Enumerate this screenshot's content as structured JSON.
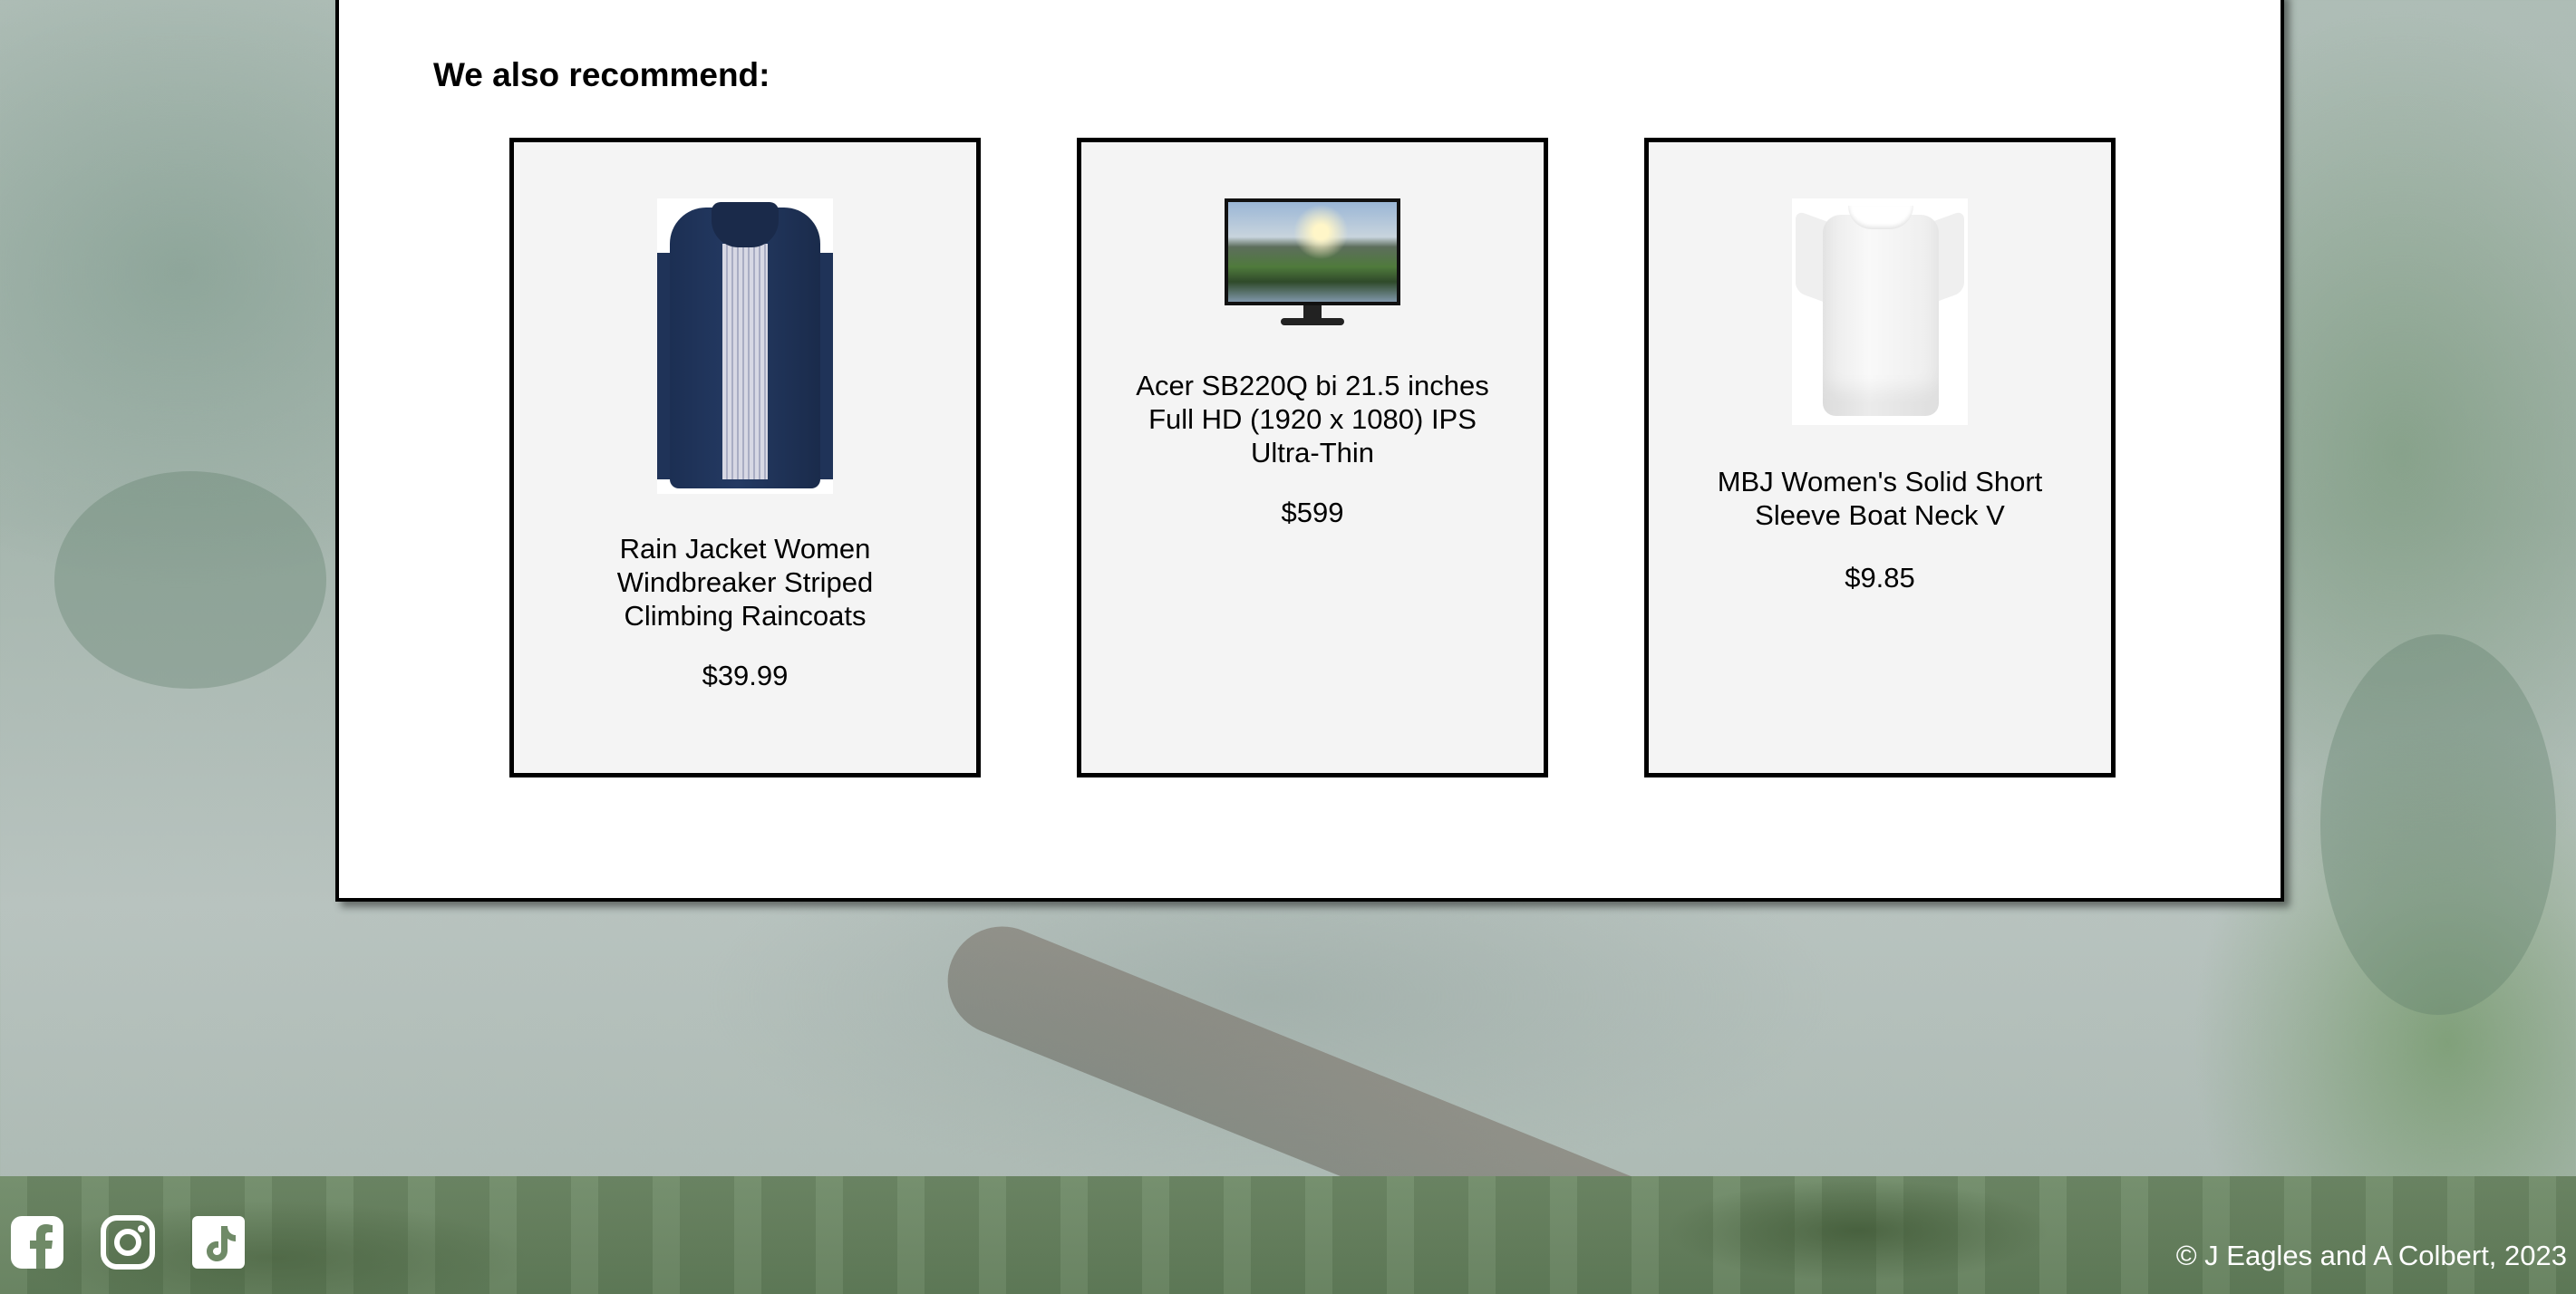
{
  "recommend": {
    "title": "We also recommend:",
    "products": [
      {
        "name": "Rain Jacket Women Windbreaker Striped Climbing Raincoats",
        "price": "$39.99",
        "image_icon": "rain-jacket-image"
      },
      {
        "name": "Acer SB220Q bi 21.5 inches Full HD (1920 x 1080) IPS Ultra-Thin",
        "price": "$599",
        "image_icon": "monitor-image"
      },
      {
        "name": "MBJ Women's Solid Short Sleeve Boat Neck V",
        "price": "$9.85",
        "image_icon": "white-shirt-image"
      }
    ]
  },
  "footer": {
    "social_icons": [
      "facebook-icon",
      "instagram-icon",
      "tiktok-icon"
    ],
    "copyright": "© J Eagles and A Colbert, 2023"
  },
  "colors": {
    "panel_background": "#ffffff",
    "card_background": "#f4f4f4",
    "border": "#000000",
    "footer_green": "#6f8a67",
    "footer_text": "#ffffff"
  }
}
